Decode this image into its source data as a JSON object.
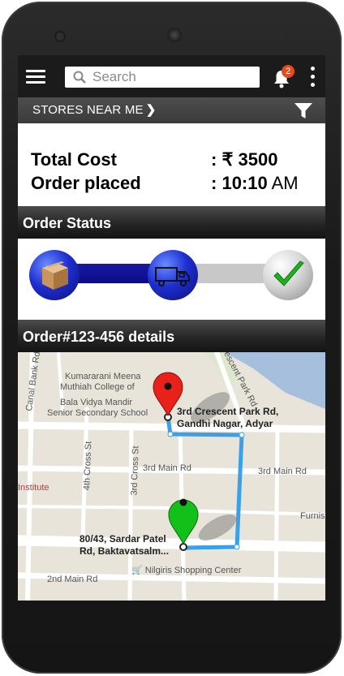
{
  "app": {
    "search_placeholder": "Search",
    "notification_count": "2",
    "stores_label": "STORES NEAR ME",
    "stores_chevron": "❯"
  },
  "order": {
    "total_cost_label": "Total Cost",
    "total_cost_value": ": ₹ 3500",
    "order_placed_label": "Order placed",
    "order_time_prefix": ": ",
    "order_time": "10:10",
    "order_time_suffix": " AM"
  },
  "status": {
    "header": "Order Status",
    "progress_steps": [
      "packed",
      "shipped",
      "delivered"
    ],
    "current_step": 2
  },
  "details": {
    "header": "Order#123-456 details"
  },
  "map": {
    "places": [
      "Kumararani Meena",
      "Muthiah College of",
      "Bala Vidya Mandir",
      "Senior Secondary School",
      "Canal Bank Rd",
      "Crescent Park Rd",
      "4th Cross St",
      "3rd Cross St",
      "3rd Main Rd",
      "3rd Main Rd",
      "Institute",
      "Furnis",
      "Nilgiris Shopping Center",
      "2nd Main Rd"
    ],
    "destination_line1": "3rd Crescent Park Rd,",
    "destination_line2": "Gandhi Nagar, Adyar",
    "origin_line1": "80/43, Sardar Patel",
    "origin_line2": "Rd, Baktavatsalm...",
    "colors": {
      "route": "#3aa0e8",
      "dest_pin": "#e8221a",
      "origin_pin": "#12c01a"
    }
  }
}
